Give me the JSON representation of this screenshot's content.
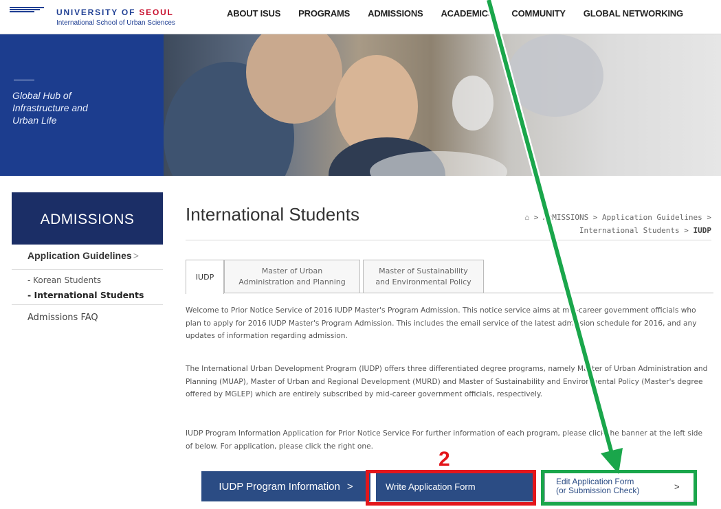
{
  "header": {
    "logo": {
      "name_part1": "UNIVERSITY OF",
      "name_part2": "SEOUL",
      "subtitle": "International School of Urban Sciences"
    },
    "nav": [
      "ABOUT ISUS",
      "PROGRAMS",
      "ADMISSIONS",
      "ACADEMICS",
      "COMMUNITY",
      "GLOBAL NETWORKING"
    ]
  },
  "hero": {
    "slogan": "Global Hub of\nInfrastructure and\nUrban Life"
  },
  "sidebar": {
    "title": "ADMISSIONS",
    "category": "Application Guidelines",
    "category_arrow": ">",
    "sub_items": [
      "- Korean Students",
      "- International Students"
    ],
    "faq": "Admissions FAQ"
  },
  "content": {
    "title": "International Students",
    "breadcrumb": {
      "home_icon": "home-icon",
      "line1": "> ADMISSIONS > Application Guidelines >",
      "line2_prefix": "International Students >",
      "current": "IUDP"
    },
    "tabs": [
      "IUDP",
      "Master of Urban\nAdministration and Planning",
      "Master of Sustainability\nand Environmental Policy"
    ],
    "paragraphs": [
      "Welcome to Prior Notice Service of 2016 IUDP Master's Program Admission. This notice service aims at mid-career government officials who plan to apply for 2016 IUDP Master's Program Admission. This includes the email service of the latest admission schedule for 2016, and any updates of information regarding admission.",
      "The International Urban Development Program (IUDP) offers three differentiated degree programs, namely Master of Urban Administration and Planning (MUAP), Master of Urban and Regional Development (MURD) and Master of Sustainability and Environmental Policy (Master's degree offered by MGLEP) which are entirely subscribed by mid-career government officials, respectively.",
      "IUDP Program Information Application for Prior Notice Service For further information of each program, please click the banner at the left side of below. For application, please click the right one."
    ],
    "buttons": {
      "info": "IUDP Program Information",
      "write": "Write Application Form",
      "edit": "Edit Application Form\n(or Submission Check)",
      "chevron": ">"
    }
  },
  "annotations": {
    "step_number": "2",
    "colors": {
      "red": "#e3161b",
      "green": "#1aa64b"
    }
  },
  "colors": {
    "brand_blue": "#1f3f93",
    "sidebar_navy": "#1b2e66",
    "button_blue": "#2b4c84"
  }
}
